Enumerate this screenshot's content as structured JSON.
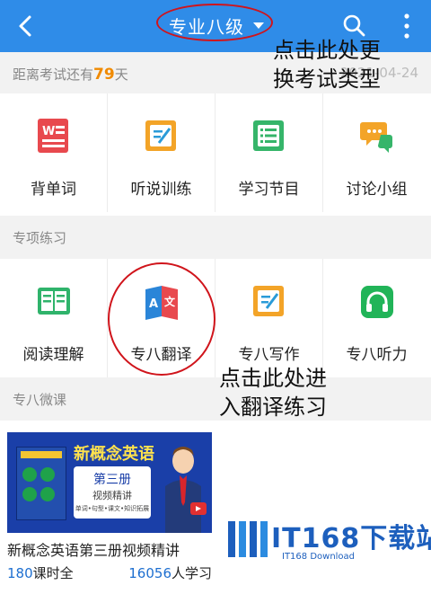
{
  "header": {
    "title": "专业八级",
    "back_icon": "chevron-left-icon",
    "dropdown_icon": "caret-down-icon",
    "search_icon": "search-icon",
    "more_icon": "more-vertical-icon",
    "bg_color": "#2f8ce8"
  },
  "countdown": {
    "prefix": "距离考试还有",
    "days": "79",
    "suffix": "天",
    "exam_date": "2021-04-24"
  },
  "annotations": {
    "title_note_line1": "点击此处更",
    "title_note_line2": "换考试类型",
    "translate_note_line1": "点击此处进",
    "translate_note_line2": "入翻译练习"
  },
  "main_tools": [
    {
      "label": "背单词",
      "icon": "word-card-icon"
    },
    {
      "label": "听说训练",
      "icon": "speaking-pen-icon"
    },
    {
      "label": "学习节目",
      "icon": "program-list-icon"
    },
    {
      "label": "讨论小组",
      "icon": "chat-bubbles-icon"
    }
  ],
  "practice_section": {
    "title": "专项练习",
    "items": [
      {
        "label": "阅读理解",
        "icon": "open-book-icon"
      },
      {
        "label": "专八翻译",
        "icon": "translate-icon",
        "icon_text_a": "A",
        "icon_text_b": "文"
      },
      {
        "label": "专八写作",
        "icon": "writing-pen-icon"
      },
      {
        "label": "专八听力",
        "icon": "headphones-icon"
      }
    ]
  },
  "course_section": {
    "title": "专八微课",
    "course": {
      "title": "新概念英语第三册视频精讲",
      "thumb_title": "新概念英语",
      "thumb_sub1": "第三册",
      "thumb_sub2": "视频精讲",
      "thumb_sub3": "单词•句型•课文•知识拓展",
      "lessons_count": "180",
      "lessons_suffix": "课时全",
      "learners_count": "16056",
      "learners_suffix": "人学习"
    }
  },
  "watermark": {
    "text": "IT168下载站",
    "sub": "IT168 Download"
  }
}
